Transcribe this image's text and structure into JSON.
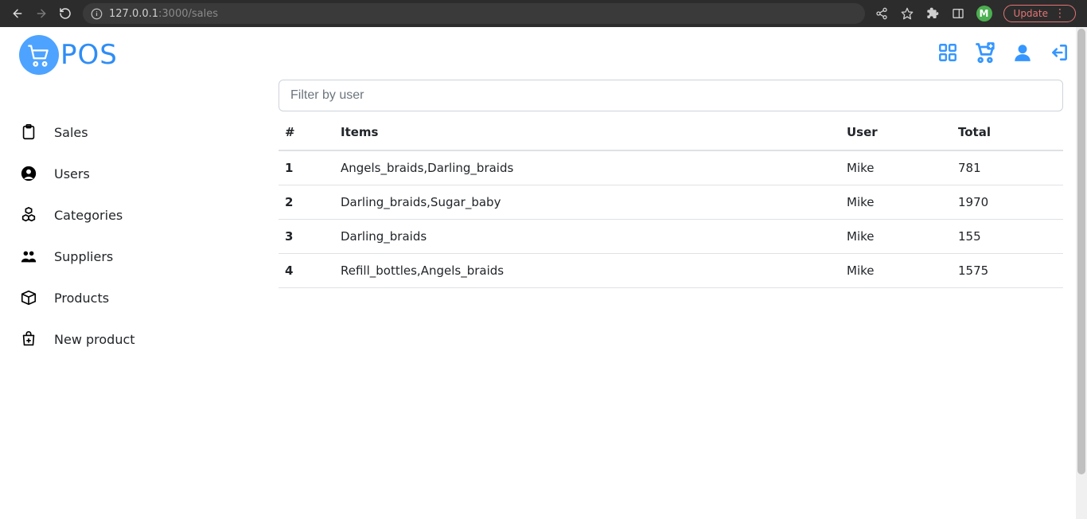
{
  "browser": {
    "url_host": "127.0.0.1",
    "url_path": ":3000/sales",
    "avatar_letter": "M",
    "update_label": "Update"
  },
  "brand": {
    "name": "POS"
  },
  "colors": {
    "accent": "#3596ff"
  },
  "sidebar": {
    "items": [
      {
        "label": "Sales"
      },
      {
        "label": "Users"
      },
      {
        "label": "Categories"
      },
      {
        "label": "Suppliers"
      },
      {
        "label": "Products"
      },
      {
        "label": "New product"
      }
    ]
  },
  "filter": {
    "placeholder": "Filter by user",
    "value": ""
  },
  "table": {
    "headers": {
      "idx": "#",
      "items": "Items",
      "user": "User",
      "total": "Total"
    },
    "rows": [
      {
        "idx": "1",
        "items": "Angels_braids,Darling_braids",
        "user": "Mike",
        "total": "781"
      },
      {
        "idx": "2",
        "items": "Darling_braids,Sugar_baby",
        "user": "Mike",
        "total": "1970"
      },
      {
        "idx": "3",
        "items": "Darling_braids",
        "user": "Mike",
        "total": "155"
      },
      {
        "idx": "4",
        "items": "Refill_bottles,Angels_braids",
        "user": "Mike",
        "total": "1575"
      }
    ]
  }
}
